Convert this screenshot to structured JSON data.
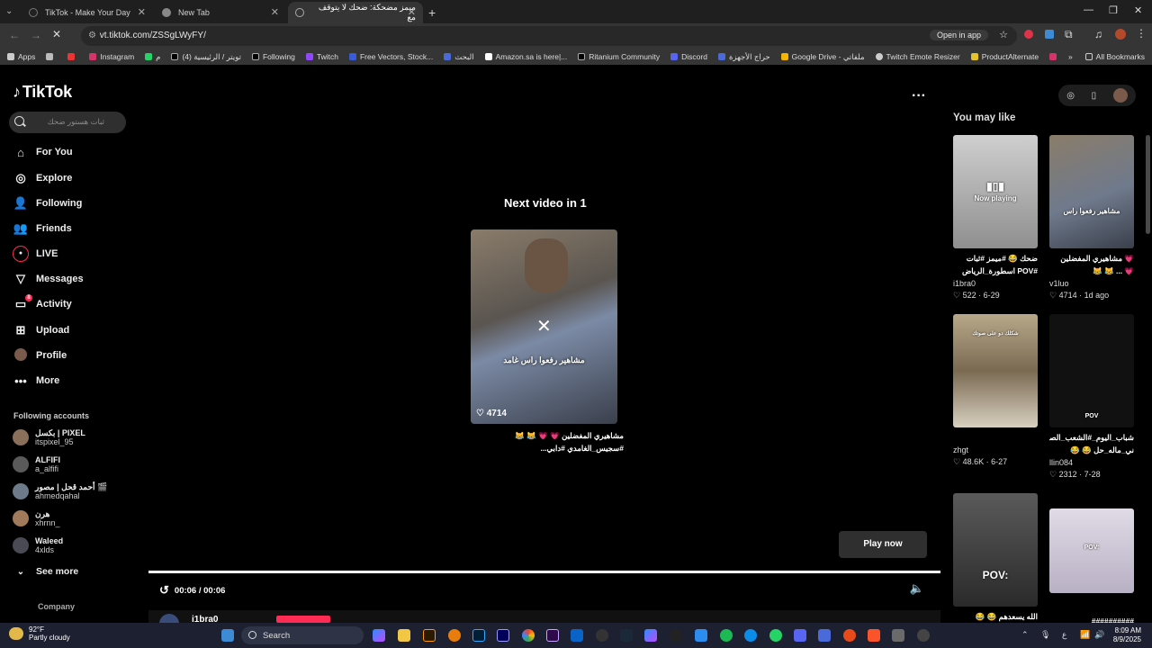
{
  "browser": {
    "tabs": [
      {
        "title": "TikTok - Make Your Day",
        "active": false
      },
      {
        "title": "New Tab",
        "active": false
      },
      {
        "title": "ميمز مضحكة: ضحك لا يتوقف مع",
        "active": true
      }
    ],
    "new_tab_label": "+",
    "url": "vt.tiktok.com/ZSSgLWyFY/",
    "open_in_app": "Open in app",
    "bookmarks": [
      "Apps",
      "Instagram",
      "م",
      "تويتر / الرئيسية (4)",
      "Following",
      "Twitch",
      "Free Vectors, Stock...",
      "البحث",
      "Amazon.sa is here|...",
      "Ritanium Community",
      "Discord",
      "حراج الأجهزة",
      "Google Drive - ملفاتي",
      "Twitch Emote Resizer",
      "ProductAlternate"
    ],
    "all_bookmarks": "All Bookmarks"
  },
  "sidebar": {
    "logo": "TikTok",
    "search_placeholder": "ثبات هستور ضحك",
    "nav": [
      {
        "label": "For You",
        "icon": "home-icon"
      },
      {
        "label": "Explore",
        "icon": "compass-icon"
      },
      {
        "label": "Following",
        "icon": "following-icon"
      },
      {
        "label": "Friends",
        "icon": "friends-icon"
      },
      {
        "label": "LIVE",
        "icon": "live-icon"
      },
      {
        "label": "Messages",
        "icon": "messages-icon"
      },
      {
        "label": "Activity",
        "icon": "activity-icon",
        "badge": "8"
      },
      {
        "label": "Upload",
        "icon": "upload-icon"
      },
      {
        "label": "Profile",
        "icon": "profile-avatar"
      },
      {
        "label": "More",
        "icon": "more-icon"
      }
    ],
    "following_title": "Following accounts",
    "accounts": [
      {
        "name": "بكسل | PIXEL",
        "user": "itspixel_95"
      },
      {
        "name": "ALFIFI",
        "user": "a_alfifi"
      },
      {
        "name": "أحمد قحل | مصور 🎬",
        "user": "ahmedqahal"
      },
      {
        "name": "هرن",
        "user": "xhrnn_"
      },
      {
        "name": "Waleed",
        "user": "4xlds"
      }
    ],
    "see_more": "See more",
    "company": "Company"
  },
  "main": {
    "next_title": "Next video in 1",
    "thumb_caption": "مشاهير رفعوا راس غامد",
    "thumb_likes": "4714",
    "next_desc": "مشاهيري المفضلين 💗 💗 😹 😹 #سجيس_الغامدي #دابي...",
    "play_now": "Play now",
    "time": "00:06 / 00:06",
    "author": "i1bra0",
    "progress": 1.0
  },
  "right": {
    "you_may_like": "You may like",
    "cards": [
      {
        "overlay": "Now playing",
        "desc": "ضحك 😂 #ميمز #ثبات #POV اسطورة_الرياض",
        "user": "i1bra0",
        "likes": "522",
        "date": "6-29",
        "colors": "#b9b9b9"
      },
      {
        "overlay": "",
        "desc": "💗 مشاهيري المفضلين 💗 ... 😹 😹 #سجيس_الغامدي",
        "user": "v1luo",
        "likes": "4714",
        "date": "1d ago",
        "colors": "#6f7a8c"
      },
      {
        "overlay": "شكلك دو على صوتك",
        "desc": "",
        "user": "zhgt",
        "likes": "48.6K",
        "date": "6-27",
        "colors": "#8a7a62"
      },
      {
        "overlay": "POV",
        "desc": "شباب_اليوم_#الشعب_الصيـ ني_ماله_حل 😂 😂 #زرقها",
        "user": "llin084",
        "likes": "2312",
        "date": "7-28",
        "colors": "#222"
      },
      {
        "overlay": "POV:",
        "desc": "الله يسعدهم 😂 😂",
        "user": "",
        "likes": "",
        "date": "",
        "colors": "#3a3a3a"
      },
      {
        "overlay": "POV:",
        "desc": "##########",
        "user": "",
        "likes": "",
        "date": "",
        "colors": "#cfc8d6"
      }
    ]
  },
  "taskbar": {
    "temp": "92°F",
    "weather": "Partly cloudy",
    "search": "Search",
    "time": "8:09 AM",
    "date": "8/9/2025"
  }
}
